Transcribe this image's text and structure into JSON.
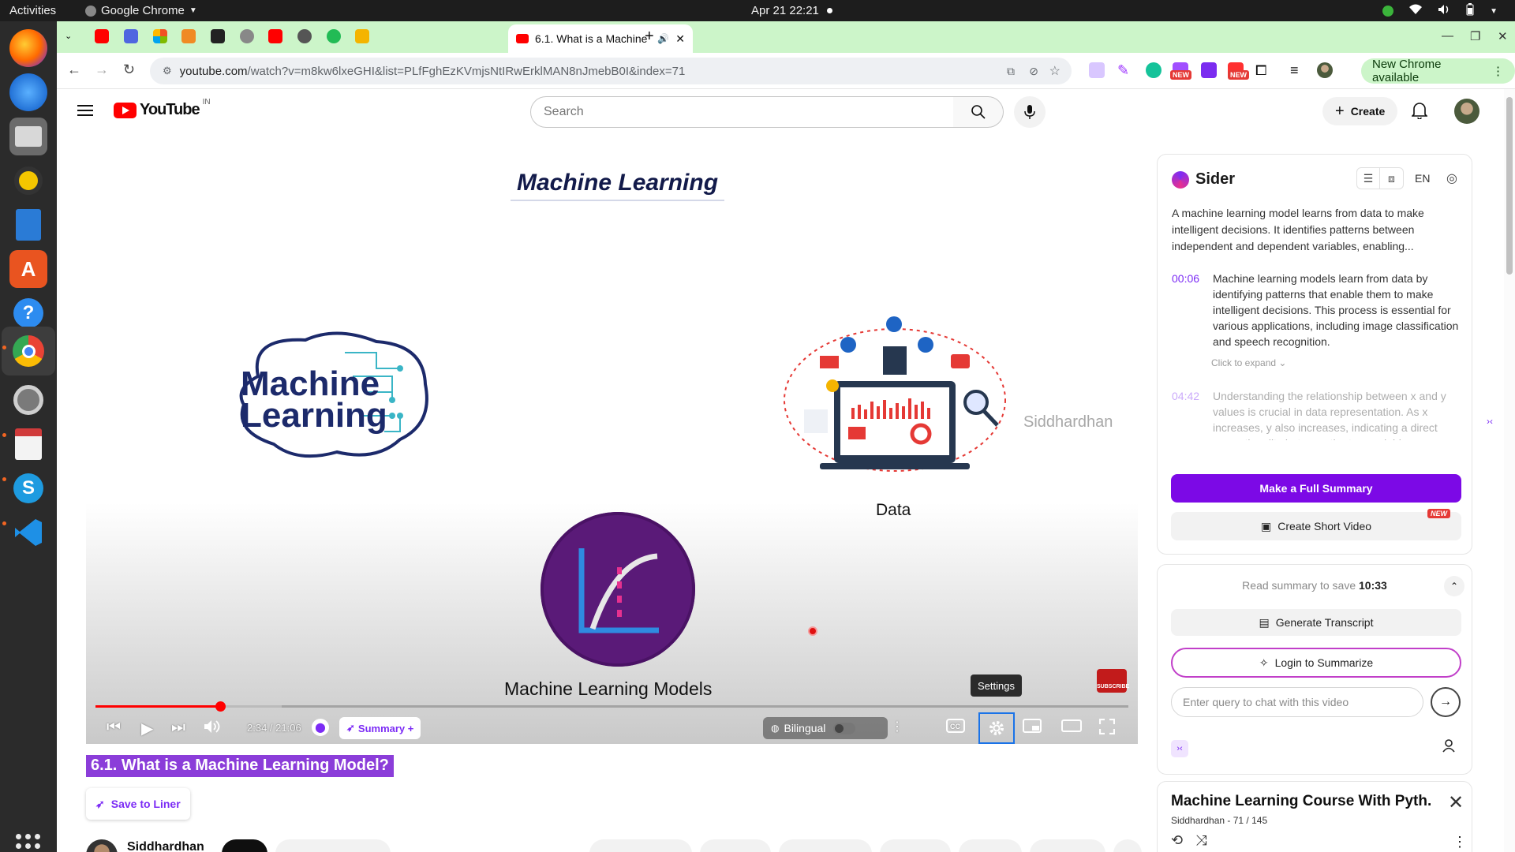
{
  "topbar": {
    "activities": "Activities",
    "app_name": "Google Chrome",
    "clock": "Apr 21  22:21"
  },
  "chrome": {
    "active_tab_title": "6.1. What is a Machine",
    "url_host": "youtube.com",
    "url_path": "/watch?v=m8kw6lxeGHI&list=PLfFghEzKVmjsNtIRwErklMAN8nJmebB0I&index=71",
    "update_chip": "New Chrome available",
    "ext_badge_new": "NEW"
  },
  "youtube": {
    "logo_text": "YouTube",
    "country_code": "IN",
    "search_placeholder": "Search",
    "create_label": "Create"
  },
  "video": {
    "slide_title": "Machine Learning",
    "brain_text_line1": "Machine",
    "brain_text_line2": "Learning",
    "watermark": "Siddhardhan",
    "data_label": "Data",
    "ml_models_label": "Machine Learning Models",
    "subscribe_badge": "SUBSCRIBE",
    "settings_tooltip": "Settings",
    "time_display": "2:34 / 21:06",
    "progress_played": 0.121,
    "progress_buffered": 0.18,
    "summary_button": "Summary +",
    "bilingual_label": "Bilingual"
  },
  "below_player": {
    "video_title": "6.1. What is a Machine Learning Model?",
    "save_to_liner": "Save to Liner",
    "channel_name": "Siddhardhan"
  },
  "sider": {
    "brand": "Sider",
    "language": "EN",
    "intro": "A machine learning model learns from data to make intelligent decisions. It identifies patterns between independent and dependent variables, enabling...",
    "chapters": [
      {
        "time": "00:06",
        "text": "Machine learning models learn from data by identifying patterns that enable them to make intelligent decisions. This process is essential for various applications, including image classification and speech recognition."
      },
      {
        "time": "04:42",
        "text": "Understanding the relationship between x and y values is crucial in data representation. As x increases, y also increases, indicating a direct proportionality between the two variables."
      }
    ],
    "expand_link": "Click to expand",
    "full_summary_button": "Make a Full Summary",
    "short_video_button": "Create Short Video",
    "short_video_badge": "NEW",
    "save_prefix": "Read summary to save",
    "save_time": "10:33",
    "transcript_button": "Generate Transcript",
    "login_button": "Login to Summarize",
    "query_placeholder": "Enter query to chat with this video"
  },
  "playlist": {
    "title": "Machine Learning Course With Pyth...",
    "channel": "Siddhardhan",
    "position": "71 / 145"
  },
  "colors": {
    "sider_purple": "#7c09e6",
    "youtube_red": "#ff0000",
    "chrome_tabstrip": "#ccf5c9",
    "title_highlight": "#8b3dd9"
  }
}
